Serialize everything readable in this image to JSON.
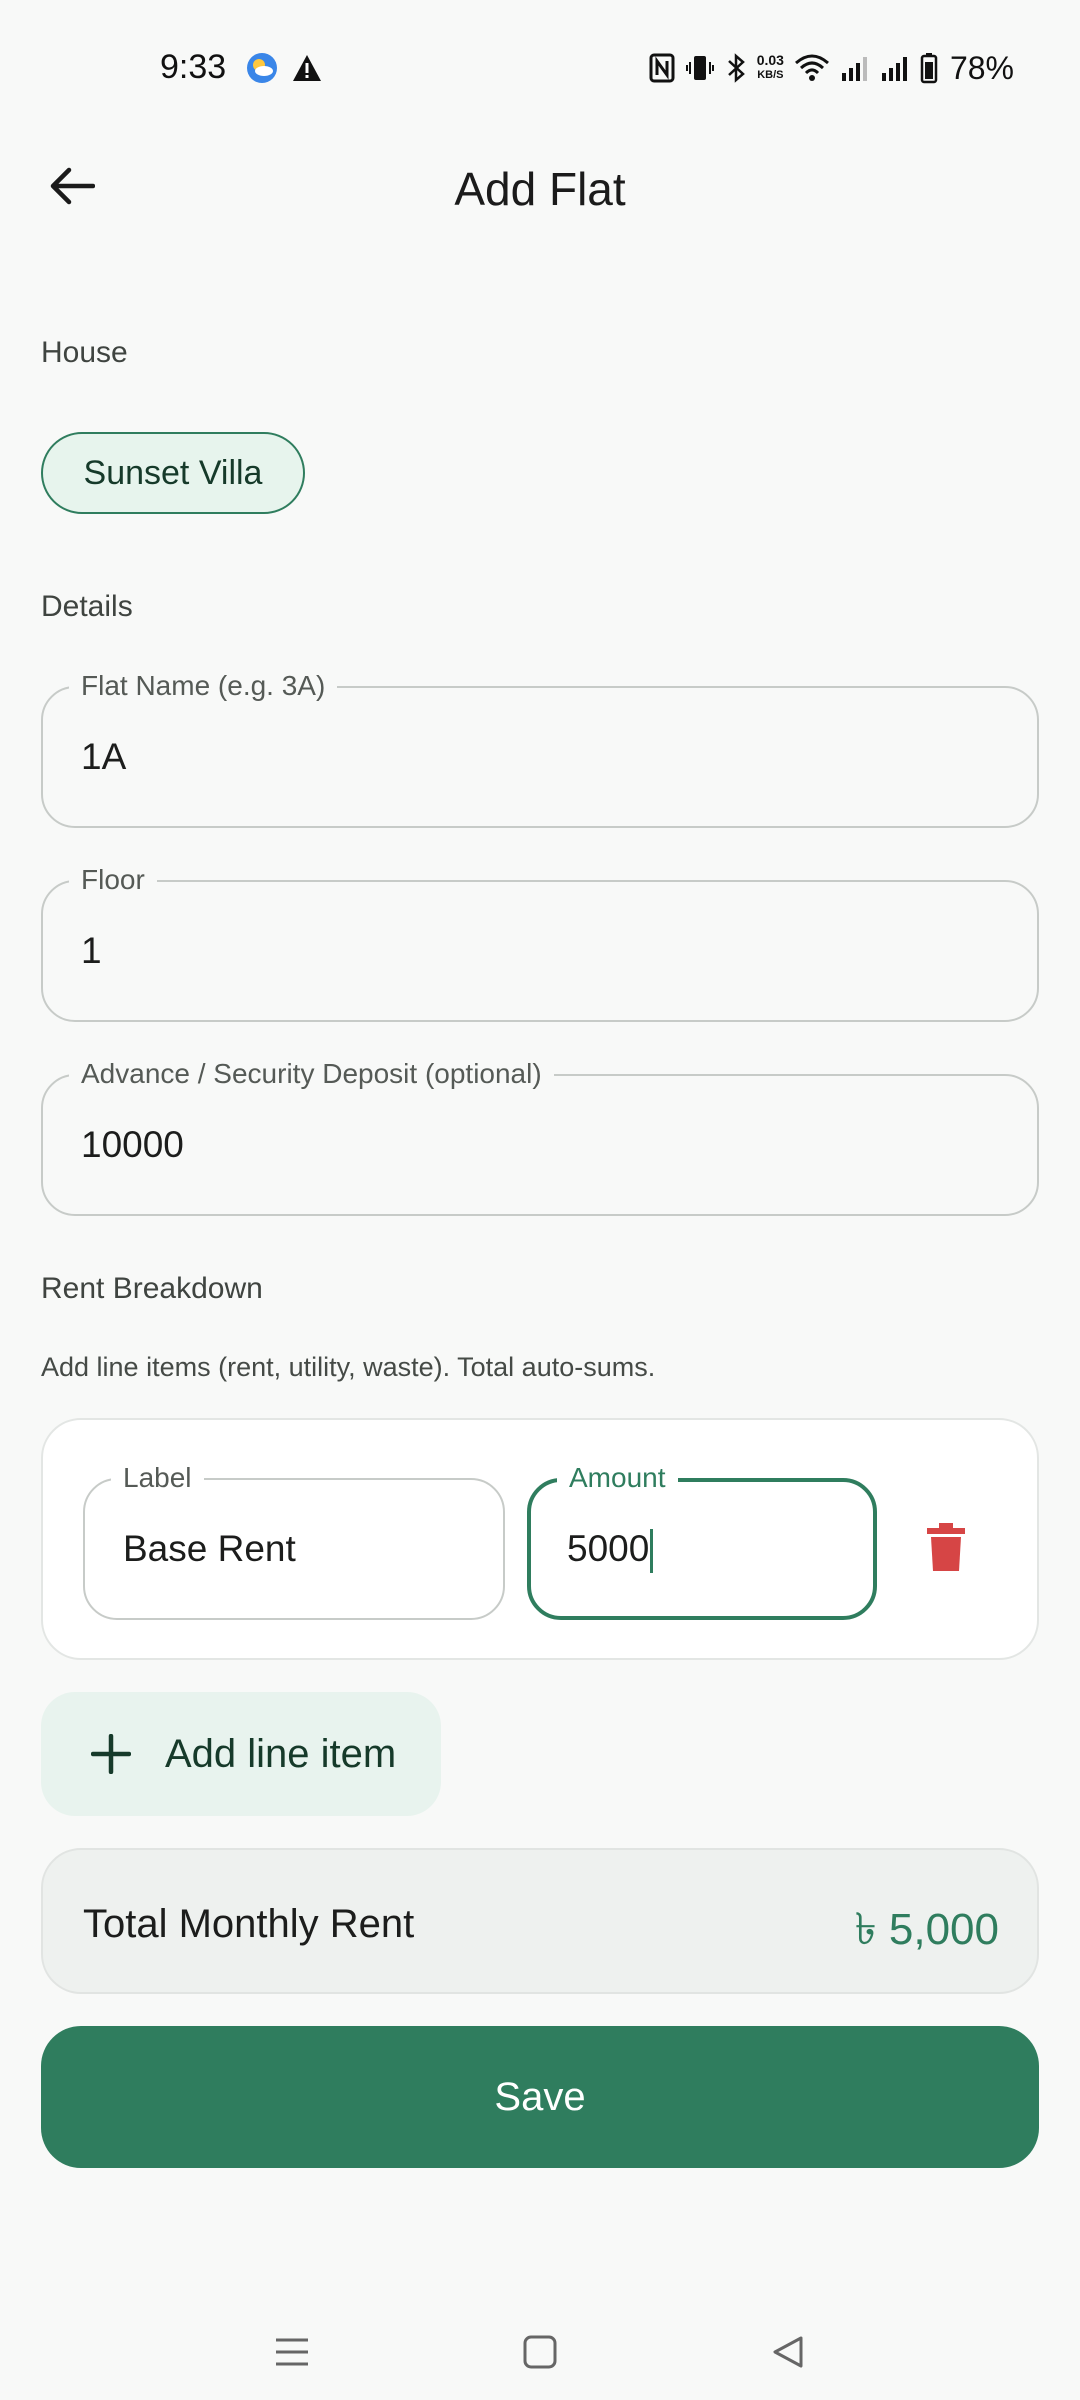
{
  "status_bar": {
    "time": "9:33",
    "net_speed_value": "0.03",
    "net_speed_unit": "KB/S",
    "battery": "78%"
  },
  "app_bar": {
    "title": "Add Flat"
  },
  "house_section": {
    "label": "House",
    "selected_house": "Sunset Villa"
  },
  "details_section": {
    "label": "Details",
    "flat_name": {
      "label": "Flat Name (e.g. 3A)",
      "value": "1A"
    },
    "floor": {
      "label": "Floor",
      "value": "1"
    },
    "deposit": {
      "label": "Advance / Security Deposit (optional)",
      "value": "10000"
    }
  },
  "rent_breakdown": {
    "label": "Rent Breakdown",
    "helper": "Add line items (rent, utility, waste). Total auto-sums.",
    "items": [
      {
        "label_field_label": "Label",
        "label_value": "Base Rent",
        "amount_field_label": "Amount",
        "amount_value": "5000"
      }
    ],
    "add_button": "Add line item"
  },
  "total": {
    "label": "Total Monthly Rent",
    "value": "৳ 5,000"
  },
  "save_button": "Save",
  "colors": {
    "primary": "#2f7d5e",
    "chip_bg": "#e7f4ed",
    "delete": "#d64545",
    "background": "#f8f9f8"
  }
}
